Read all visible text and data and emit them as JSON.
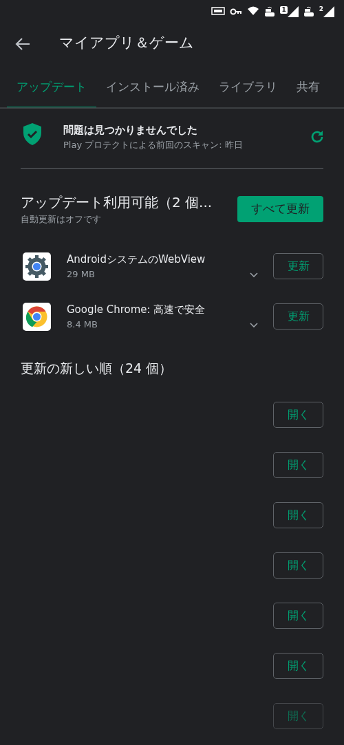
{
  "status_bar": {
    "sim_1": "1",
    "sim_2": "2"
  },
  "toolbar": {
    "title": "マイアプリ＆ゲーム"
  },
  "tabs": [
    {
      "label": "アップデート",
      "selected": true
    },
    {
      "label": "インストール済み",
      "selected": false
    },
    {
      "label": "ライブラリ",
      "selected": false
    },
    {
      "label": "共有",
      "selected": false
    }
  ],
  "protect": {
    "title": "問題は見つかりませんでした",
    "subtitle": "Play プロテクトによる前回のスキャン: 昨日"
  },
  "updates": {
    "title": "アップデート利用可能（2 個...",
    "subtitle": "自動更新はオフです",
    "button": "すべて更新",
    "apps": [
      {
        "kind": "webview",
        "name": "AndroidシステムのWebView",
        "size": "29 MB",
        "button": "更新"
      },
      {
        "kind": "chrome",
        "name": "Google Chrome: 高速で安全",
        "size": "8.4 MB",
        "button": "更新"
      }
    ]
  },
  "recent": {
    "title": "更新の新しい順（24 個）",
    "items": [
      {
        "button": "開く",
        "faded": false
      },
      {
        "button": "開く",
        "faded": false
      },
      {
        "button": "開く",
        "faded": false
      },
      {
        "button": "開く",
        "faded": false
      },
      {
        "button": "開く",
        "faded": false
      },
      {
        "button": "開く",
        "faded": false
      },
      {
        "button": "開く",
        "faded": true
      }
    ]
  }
}
